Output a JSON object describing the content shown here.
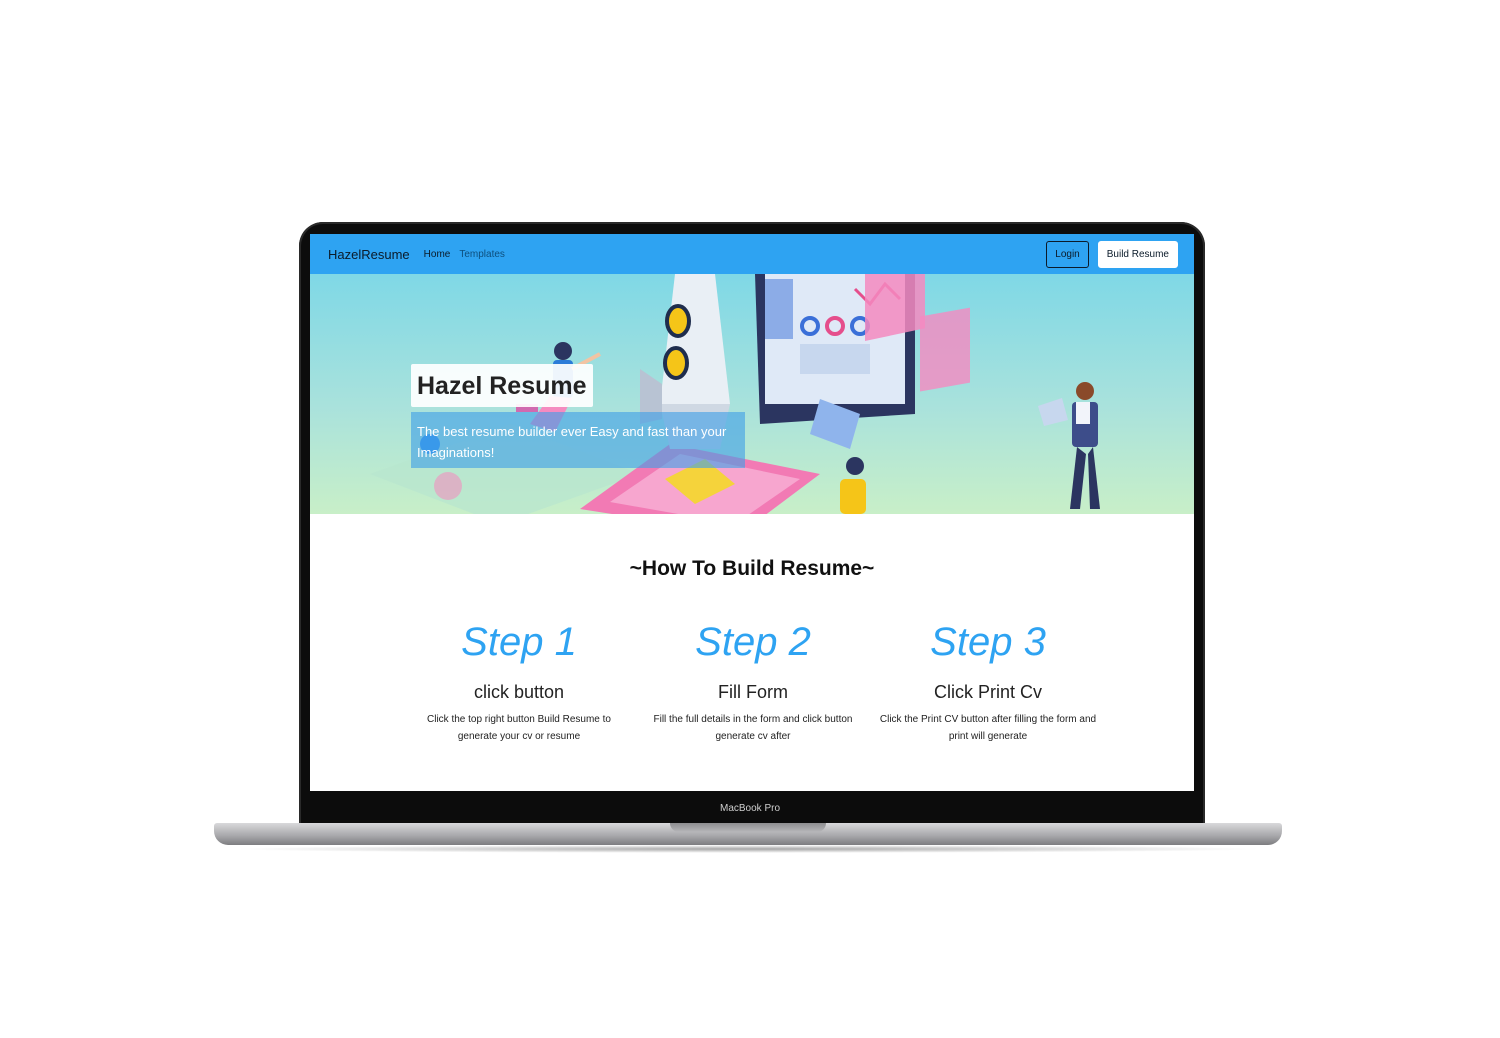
{
  "device": {
    "label": "MacBook Pro"
  },
  "navbar": {
    "brand": "HazelResume",
    "links": [
      {
        "label": "Home"
      },
      {
        "label": "Templates"
      }
    ],
    "login_label": "Login",
    "build_label": "Build Resume"
  },
  "hero": {
    "title": "Hazel Resume",
    "subtitle": "The best resume builder ever Easy and fast than your Imaginations!"
  },
  "how": {
    "title": "~How To Build Resume~",
    "steps": [
      {
        "number": "Step 1",
        "title": "click button",
        "desc": "Click the top right button Build Resume to generate your cv or resume"
      },
      {
        "number": "Step 2",
        "title": "Fill Form",
        "desc": "Fill the full details in the form and click button generate cv after"
      },
      {
        "number": "Step 3",
        "title": "Click Print Cv",
        "desc": "Click the Print CV button after filling the form and print will generate"
      }
    ]
  },
  "colors": {
    "accent": "#2ea3f2",
    "navbar": "#2ea3f2",
    "frame": "#0c0c0c"
  }
}
